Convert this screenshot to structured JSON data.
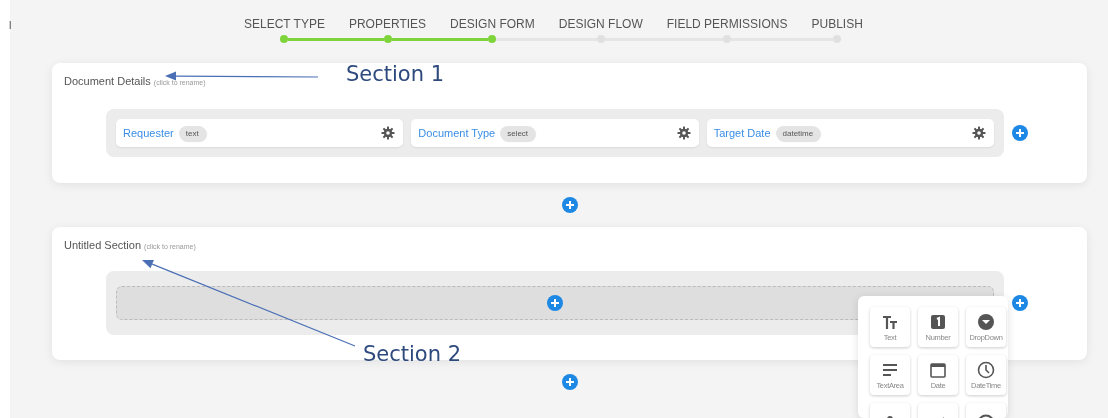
{
  "edge_text": "l",
  "steps": [
    {
      "label": "SELECT TYPE",
      "completed": true
    },
    {
      "label": "PROPERTIES",
      "completed": true
    },
    {
      "label": "DESIGN FORM",
      "completed": true
    },
    {
      "label": "DESIGN FLOW",
      "completed": false
    },
    {
      "label": "FIELD PERMISSIONS",
      "completed": false
    },
    {
      "label": "PUBLISH",
      "completed": false
    }
  ],
  "sections": [
    {
      "title": "Document Details",
      "hint": "(click to rename)",
      "fields": [
        {
          "name": "Requester",
          "type": "text"
        },
        {
          "name": "Document Type",
          "type": "select"
        },
        {
          "name": "Target Date",
          "type": "datetime"
        }
      ]
    },
    {
      "title": "Untitled Section",
      "hint": "(click to rename)"
    }
  ],
  "field_palette": [
    {
      "label": "Text",
      "kind": "text"
    },
    {
      "label": "Number",
      "kind": "number"
    },
    {
      "label": "DropDown",
      "kind": "dropdown"
    },
    {
      "label": "TextArea",
      "kind": "textarea"
    },
    {
      "label": "Date",
      "kind": "date"
    },
    {
      "label": "DateTime",
      "kind": "datetime"
    },
    {
      "kind": "person"
    },
    {
      "kind": "check"
    },
    {
      "kind": "radio"
    }
  ],
  "annotations": [
    {
      "label": "Section 1"
    },
    {
      "label": "Section 2"
    }
  ]
}
